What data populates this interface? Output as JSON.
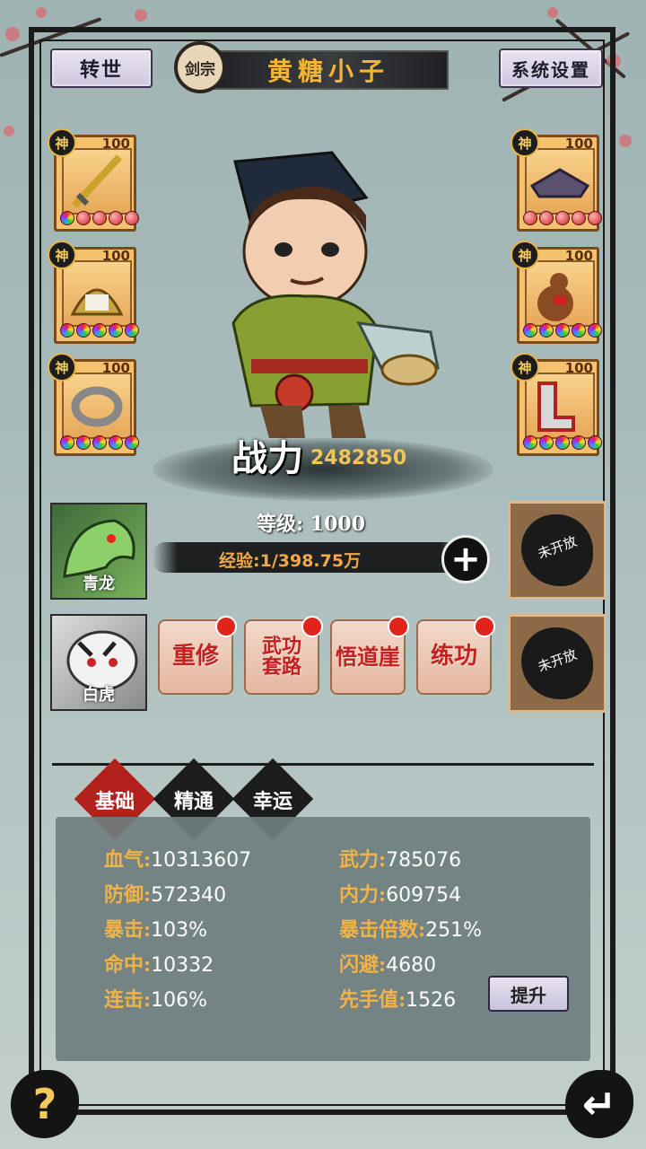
{
  "header": {
    "rebirth_label": "转世",
    "sect_badge": "剑宗",
    "player_name": "黄糖小子",
    "settings_label": "系统设置"
  },
  "equipment": {
    "left": [
      {
        "name": "sword",
        "tier": "神",
        "level": "100"
      },
      {
        "name": "helmet",
        "tier": "神",
        "level": "100"
      },
      {
        "name": "ring",
        "tier": "神",
        "level": "100"
      }
    ],
    "right": [
      {
        "name": "hat",
        "tier": "神",
        "level": "100"
      },
      {
        "name": "gourd",
        "tier": "神",
        "level": "100"
      },
      {
        "name": "boots",
        "tier": "神",
        "level": "100"
      }
    ]
  },
  "hero": {
    "power_label": "战力",
    "power_value": "2482850",
    "level_text": "等级: 1000",
    "exp_text": "经验:1/398.75万"
  },
  "pets": [
    {
      "name": "青龙"
    },
    {
      "name": "白虎"
    }
  ],
  "locked_slots": [
    "未开放",
    "未开放"
  ],
  "actions": [
    {
      "label": "重修"
    },
    {
      "label": "武功套路"
    },
    {
      "label": "悟道崖"
    },
    {
      "label": "练功"
    }
  ],
  "tabs": [
    {
      "label": "基础",
      "active": true
    },
    {
      "label": "精通",
      "active": false
    },
    {
      "label": "幸运",
      "active": false
    }
  ],
  "stats": {
    "left": [
      {
        "key": "血气:",
        "value": "10313607"
      },
      {
        "key": "防御:",
        "value": "572340"
      },
      {
        "key": "暴击:",
        "value": "103%"
      },
      {
        "key": "命中:",
        "value": "10332"
      },
      {
        "key": "连击:",
        "value": "106%"
      }
    ],
    "right": [
      {
        "key": "武力:",
        "value": "785076"
      },
      {
        "key": "内力:",
        "value": "609754"
      },
      {
        "key": "暴击倍数:",
        "value": "251%"
      },
      {
        "key": "闪避:",
        "value": "4680"
      },
      {
        "key": "先手值:",
        "value": "1526"
      }
    ]
  },
  "upgrade_label": "提升",
  "footer": {
    "help_glyph": "?",
    "back_glyph": "↵"
  },
  "colors": {
    "accent_gold": "#f2b346",
    "action_red": "#c4201f",
    "active_tab": "#b3211d"
  }
}
